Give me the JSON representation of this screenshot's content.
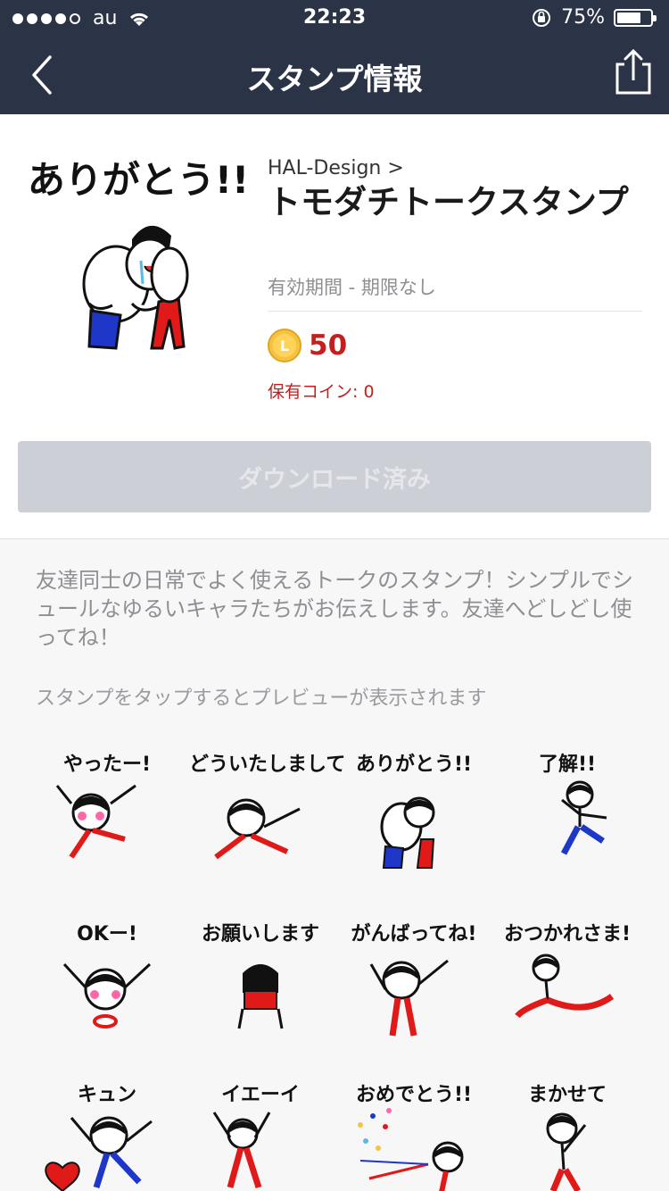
{
  "status_bar": {
    "carrier": "au",
    "time": "22:23",
    "battery_percent": "75%",
    "battery_level": 0.75
  },
  "nav": {
    "title": "スタンプ情報",
    "back_icon": "chevron-left-icon",
    "share_icon": "share-icon"
  },
  "sticker_pack": {
    "main_sticker_text": "ありがとう!!",
    "author": "HAL-Design",
    "title": "トモダチトークスタンプ",
    "validity": "有効期間 - 期限なし",
    "coin_symbol": "L",
    "price": "50",
    "coins_owned": "保有コイン: 0",
    "download_label": "ダウンロード済み"
  },
  "description": "友達同士の日常でよく使えるトークのスタンプ！シンプルでシュールなゆるいキャラたちがお伝えします。友達へどしどし使ってね！",
  "preview_hint": "スタンプをタップするとプレビューが表示されます",
  "stickers": [
    {
      "text": "やったー!"
    },
    {
      "text": "どういたしまして"
    },
    {
      "text": "ありがとう!!"
    },
    {
      "text": "了解!!"
    },
    {
      "text": "OKー!"
    },
    {
      "text": "お願いします"
    },
    {
      "text": "がんばってね!"
    },
    {
      "text": "おつかれさま!"
    },
    {
      "text": "キュン"
    },
    {
      "text": "イエーイ"
    },
    {
      "text": "おめでとう!!"
    },
    {
      "text": "まかせて"
    }
  ],
  "colors": {
    "nav_background": "#2b3447",
    "price_red": "#c41e1e",
    "coin_gold": "#f5c242",
    "button_disabled": "#cdcfd7"
  }
}
